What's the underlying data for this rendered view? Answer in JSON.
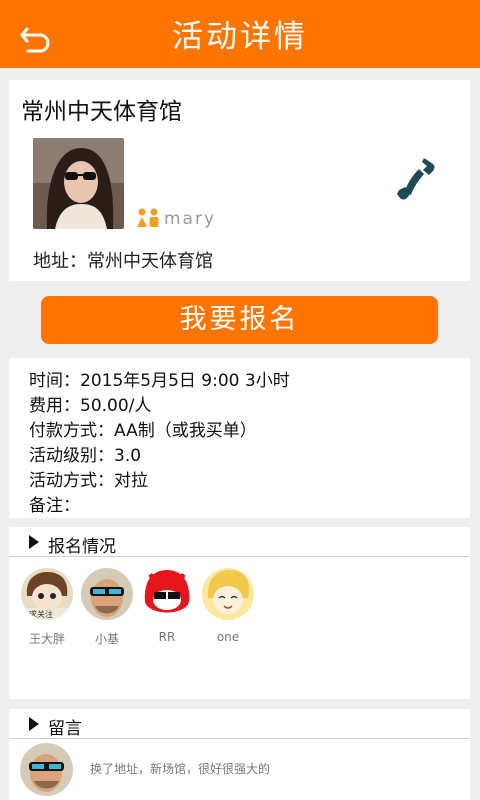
{
  "header": {
    "title": "活动详情"
  },
  "venue": {
    "name": "常州中天体育馆",
    "organizer_name": "mary",
    "address": "地址：常州中天体育馆"
  },
  "actions": {
    "signup_label": "我要报名"
  },
  "details": {
    "time": "时间：2015年5月5日 9:00 3小时",
    "fee": "费用：50.00/人",
    "payment": "付款方式：AA制（或我买单）",
    "level": "活动级别：3.0",
    "mode": "活动方式：对拉",
    "note": "备注："
  },
  "enrollment": {
    "header": "报名情况",
    "members": [
      {
        "name": "王大胖"
      },
      {
        "name": "小基"
      },
      {
        "name": "RR"
      },
      {
        "name": "one"
      }
    ]
  },
  "comments": {
    "header": "留言",
    "items": [
      {
        "text": "换了地址，新场馆，很好很强大的"
      }
    ]
  },
  "colors": {
    "accent": "#ff7500",
    "phone_icon": "#1f4a57",
    "gender_icon": "#f0a020"
  }
}
